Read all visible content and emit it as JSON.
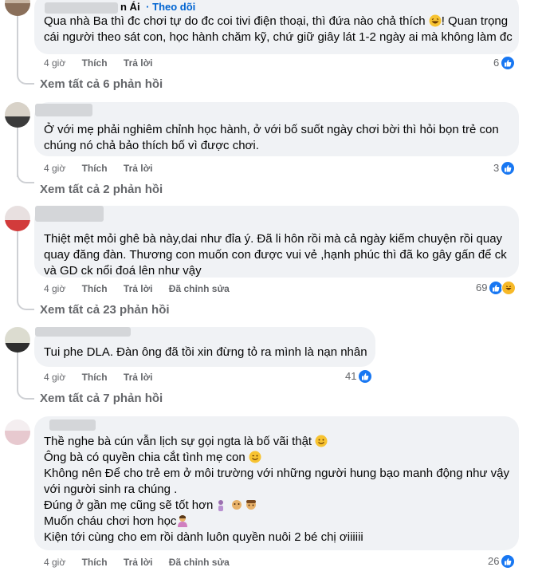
{
  "comments": [
    {
      "author_suffix": "n Ái",
      "follow_label": "Theo dõi",
      "lines": [
        "Qua nhà Ba thì đc chơi tự do đc coi tivi điện thoại, thì đứa nào chả thích",
        "cái người theo sát con, học hành chăm kỹ, chứ giữ giây lát 1-2 ngày ai mà không làm đc"
      ],
      "line1_tail": "! Quan trọng",
      "time": "4 giờ",
      "like": "Thích",
      "reply": "Trả lời",
      "reactions": "6",
      "replies": "Xem tất cả 6 phản hồi"
    },
    {
      "lines": [
        "Ở với mẹ phải nghiêm chỉnh học hành, ở với bố suốt ngày chơi bời thì hỏi bọn trẻ con",
        "chúng nó chả bảo thích bố vì được chơi."
      ],
      "time": "4 giờ",
      "like": "Thích",
      "reply": "Trả lời",
      "reactions": "3",
      "replies": "Xem tất cả 2 phản hồi"
    },
    {
      "lines": [
        "Thiệt mệt mỏi ghê bà này,dai như đỉa ý. Đã li hôn rồi mà cả ngày kiếm chuyện rồi quay",
        "quay đăng đàn. Thương con muốn con được vui vẻ ,hạnh phúc thì đã ko gây gấn để ck",
        "và GD ck nổi đoá lên như vậy"
      ],
      "time": "4 giờ",
      "like": "Thích",
      "reply": "Trả lời",
      "edited": "Đã chỉnh sửa",
      "reactions": "69",
      "replies": "Xem tất cả 23 phản hồi"
    },
    {
      "lines": [
        "Tui phe DLA. Đàn ông đã tồi xin đừng tỏ ra mình là nạn nhân"
      ],
      "time": "4 giờ",
      "like": "Thích",
      "reply": "Trả lời",
      "reactions": "41",
      "replies": "Xem tất cả 7 phản hồi"
    },
    {
      "lines": [
        "Thề nghe bà cún vẫn lịch sự gọi ngta là bố vãi thật",
        "Ông bà có quyền chia cắt tình mẹ con",
        "Không nên Để cho trẻ em ở môi trường với những người hung bạo manh động như vậy",
        "với người sinh ra chúng .",
        "Đúng ở gần mẹ cũng sẽ tốt hơn",
        "Muốn cháu chơi hơn học",
        "Kiện tới cùng cho em rồi dành luôn quyền nuôi 2 bé chị ơiiiiii"
      ],
      "time": "4 giờ",
      "like": "Thích",
      "reply": "Trả lời",
      "edited": "Đã chỉnh sửa",
      "reactions": "26"
    }
  ],
  "icons": {
    "like": "thumbs-up-icon",
    "haha": "laughing-face-icon",
    "smile": "smiling-face-icon",
    "wink": "winking-face-icon",
    "family": "family-emoji-icon",
    "person": "person-emoji-icon"
  },
  "colors": {
    "bubble": "#f0f2f5",
    "link": "#0064d1",
    "meta": "#65676b",
    "like": "#1877f2"
  }
}
